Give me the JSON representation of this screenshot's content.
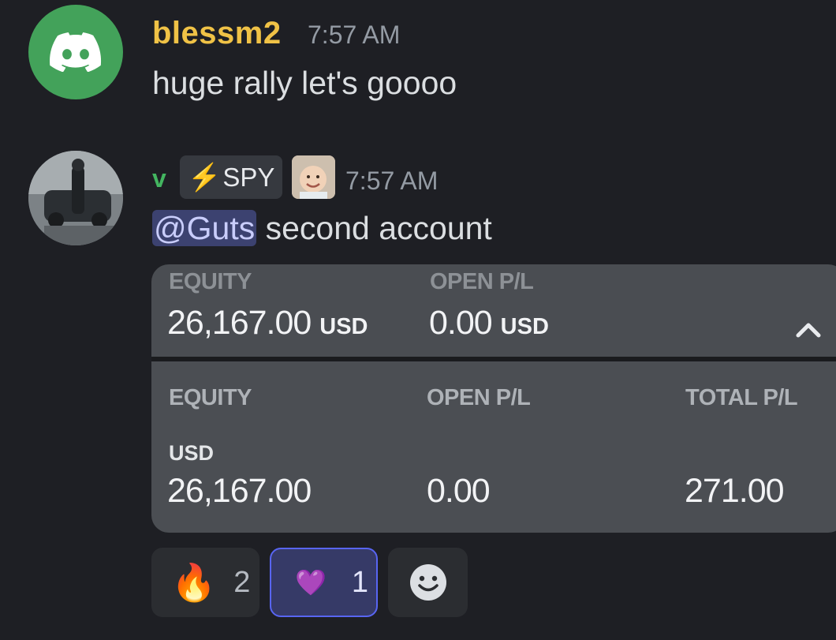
{
  "messages": [
    {
      "username": "blessm2",
      "username_color": "#f0c246",
      "timestamp": "7:57 AM",
      "text": "huge rally let's goooo",
      "avatar_icon": "discord-logo-icon"
    },
    {
      "username": "v",
      "username_color": "#43b560",
      "role_tag": {
        "icon": "⚡",
        "label": "SPY"
      },
      "timestamp": "7:57 AM",
      "mention": "@Guts",
      "text": " second account",
      "avatar_icon": "user-photo-avatar"
    }
  ],
  "embed": {
    "top_panel": {
      "equity_label": "EQUITY",
      "equity_value": "26,167.00",
      "equity_currency": "USD",
      "open_pl_label": "OPEN P/L",
      "open_pl_value": "0.00",
      "open_pl_currency": "USD",
      "toggle_icon": "chevron-up-icon"
    },
    "bottom_panel": {
      "equity_label": "EQUITY",
      "open_pl_label": "OPEN P/L",
      "total_pl_label": "TOTAL P/L",
      "currency": "USD",
      "equity_value": "26,167.00",
      "open_pl_value": "0.00",
      "total_pl_value": "271.00"
    }
  },
  "reactions": [
    {
      "emoji": "🔥",
      "count": "2",
      "active": false
    },
    {
      "emoji": "💜",
      "count": "1",
      "active": true
    },
    {
      "emoji": "add-reaction-smiley-icon",
      "count": "",
      "active": false
    }
  ]
}
